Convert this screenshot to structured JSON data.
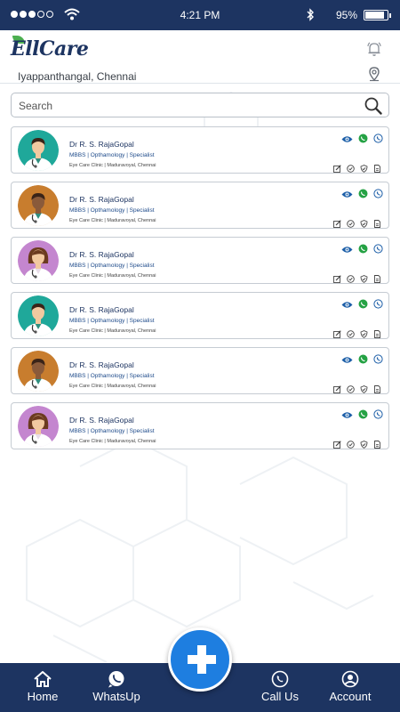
{
  "status_bar": {
    "time": "4:21 PM",
    "battery": "95%"
  },
  "header": {
    "logo_text": "EllCare",
    "location": "Iyappanthangal, Chennai"
  },
  "search": {
    "placeholder": "Search"
  },
  "doctors": [
    {
      "name": "Dr R. S. RajaGopal",
      "specialty": "MBBS | Opthamology | Specialist",
      "clinic": "Eye Care Clinic | Maduravoyal, Chennai",
      "avatar": "male-doctor-teal"
    },
    {
      "name": "Dr R. S. RajaGopal",
      "specialty": "MBBS | Opthamology | Specialist",
      "clinic": "Eye Care Clinic | Maduravoyal, Chennai",
      "avatar": "male-doctor-orange"
    },
    {
      "name": "Dr R. S. RajaGopal",
      "specialty": "MBBS | Opthamology | Specialist",
      "clinic": "Eye Care Clinic | Maduravoyal, Chennai",
      "avatar": "female-doctor-purple"
    },
    {
      "name": "Dr R. S. RajaGopal",
      "specialty": "MBBS | Opthamology | Specialist",
      "clinic": "Eye Care Clinic | Maduravoyal, Chennai",
      "avatar": "male-doctor-teal"
    },
    {
      "name": "Dr R. S. RajaGopal",
      "specialty": "MBBS | Opthamology | Specialist",
      "clinic": "Eye Care Clinic | Maduravoyal, Chennai",
      "avatar": "male-doctor-orange"
    },
    {
      "name": "Dr R. S. RajaGopal",
      "specialty": "MBBS | Opthamology | Specialist",
      "clinic": "Eye Care Clinic | Maduravoyal, Chennai",
      "avatar": "female-doctor-purple"
    }
  ],
  "nav": {
    "home": "Home",
    "whatsapp": "WhatsUp",
    "call": "Call Us",
    "account": "Account"
  },
  "colors": {
    "primary": "#1d3461",
    "accent": "#1e7ee0",
    "whatsapp_green": "#25a244",
    "avatar_teal": "#1fa89a",
    "avatar_orange": "#c87d2e",
    "avatar_purple": "#c486cf"
  }
}
